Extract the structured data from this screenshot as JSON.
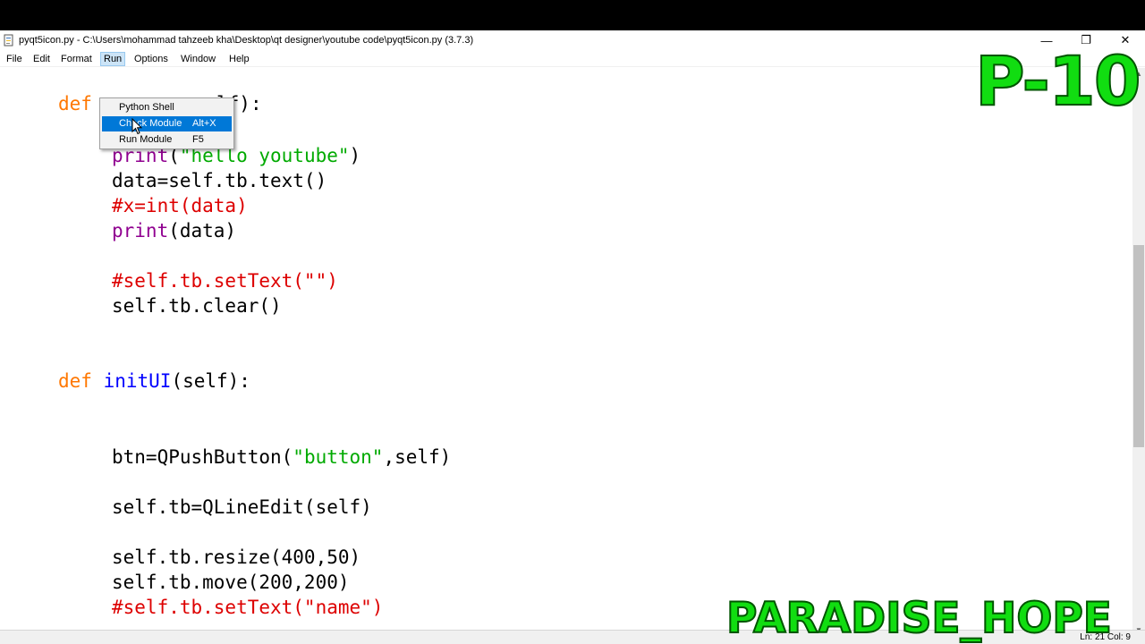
{
  "window": {
    "title": "pyqt5icon.py - C:\\Users\\mohammad tahzeeb kha\\Desktop\\qt designer\\youtube code\\pyqt5icon.py (3.7.3)",
    "minimize_glyph": "—",
    "maximize_glyph": "❐",
    "close_glyph": "✕"
  },
  "menubar": {
    "items": [
      "File",
      "Edit",
      "Format",
      "Run",
      "Options",
      "Window",
      "Help"
    ],
    "active": "Run"
  },
  "run_menu": {
    "items": [
      {
        "label": "Python Shell",
        "accel": ""
      },
      {
        "label": "Check Module",
        "accel": "Alt+X"
      },
      {
        "label": "Run Module",
        "accel": "F5"
      }
    ],
    "selected": "Check Module"
  },
  "code": {
    "line1": {
      "kw": "def",
      "rest": "elf):"
    },
    "line2": {
      "fn": "print",
      "open": "(",
      "str": "\"hello youtube\"",
      "close": ")"
    },
    "line3": "data=self.tb.text()",
    "line4": "#x=int(data)",
    "line5": {
      "fn": "print",
      "rest": "(data)"
    },
    "line6": "#self.tb.setText(\"\")",
    "line7": "self.tb.clear()",
    "line8": {
      "kw": "def",
      "name": "initUI",
      "rest": "(self):"
    },
    "line9": {
      "pre": "btn=QPushButton(",
      "str": "\"button\"",
      "post": ",self)"
    },
    "line10": "self.tb=QLineEdit(self)",
    "line11": "self.tb.resize(400,50)",
    "line12": "self.tb.move(200,200)",
    "line13": "#self.tb.setText(\"name\")"
  },
  "statusbar": {
    "position": "Ln: 21  Col: 9"
  },
  "watermarks": {
    "top": "P-10",
    "bottom": "PARADISE_HOPE"
  },
  "colors": {
    "keyword": "#ff7700",
    "builtin": "#900090",
    "string": "#00aa00",
    "comment": "#dd0000",
    "definition": "#0000ff",
    "menu_selected": "#0078d7",
    "watermark": "#11dd11"
  }
}
